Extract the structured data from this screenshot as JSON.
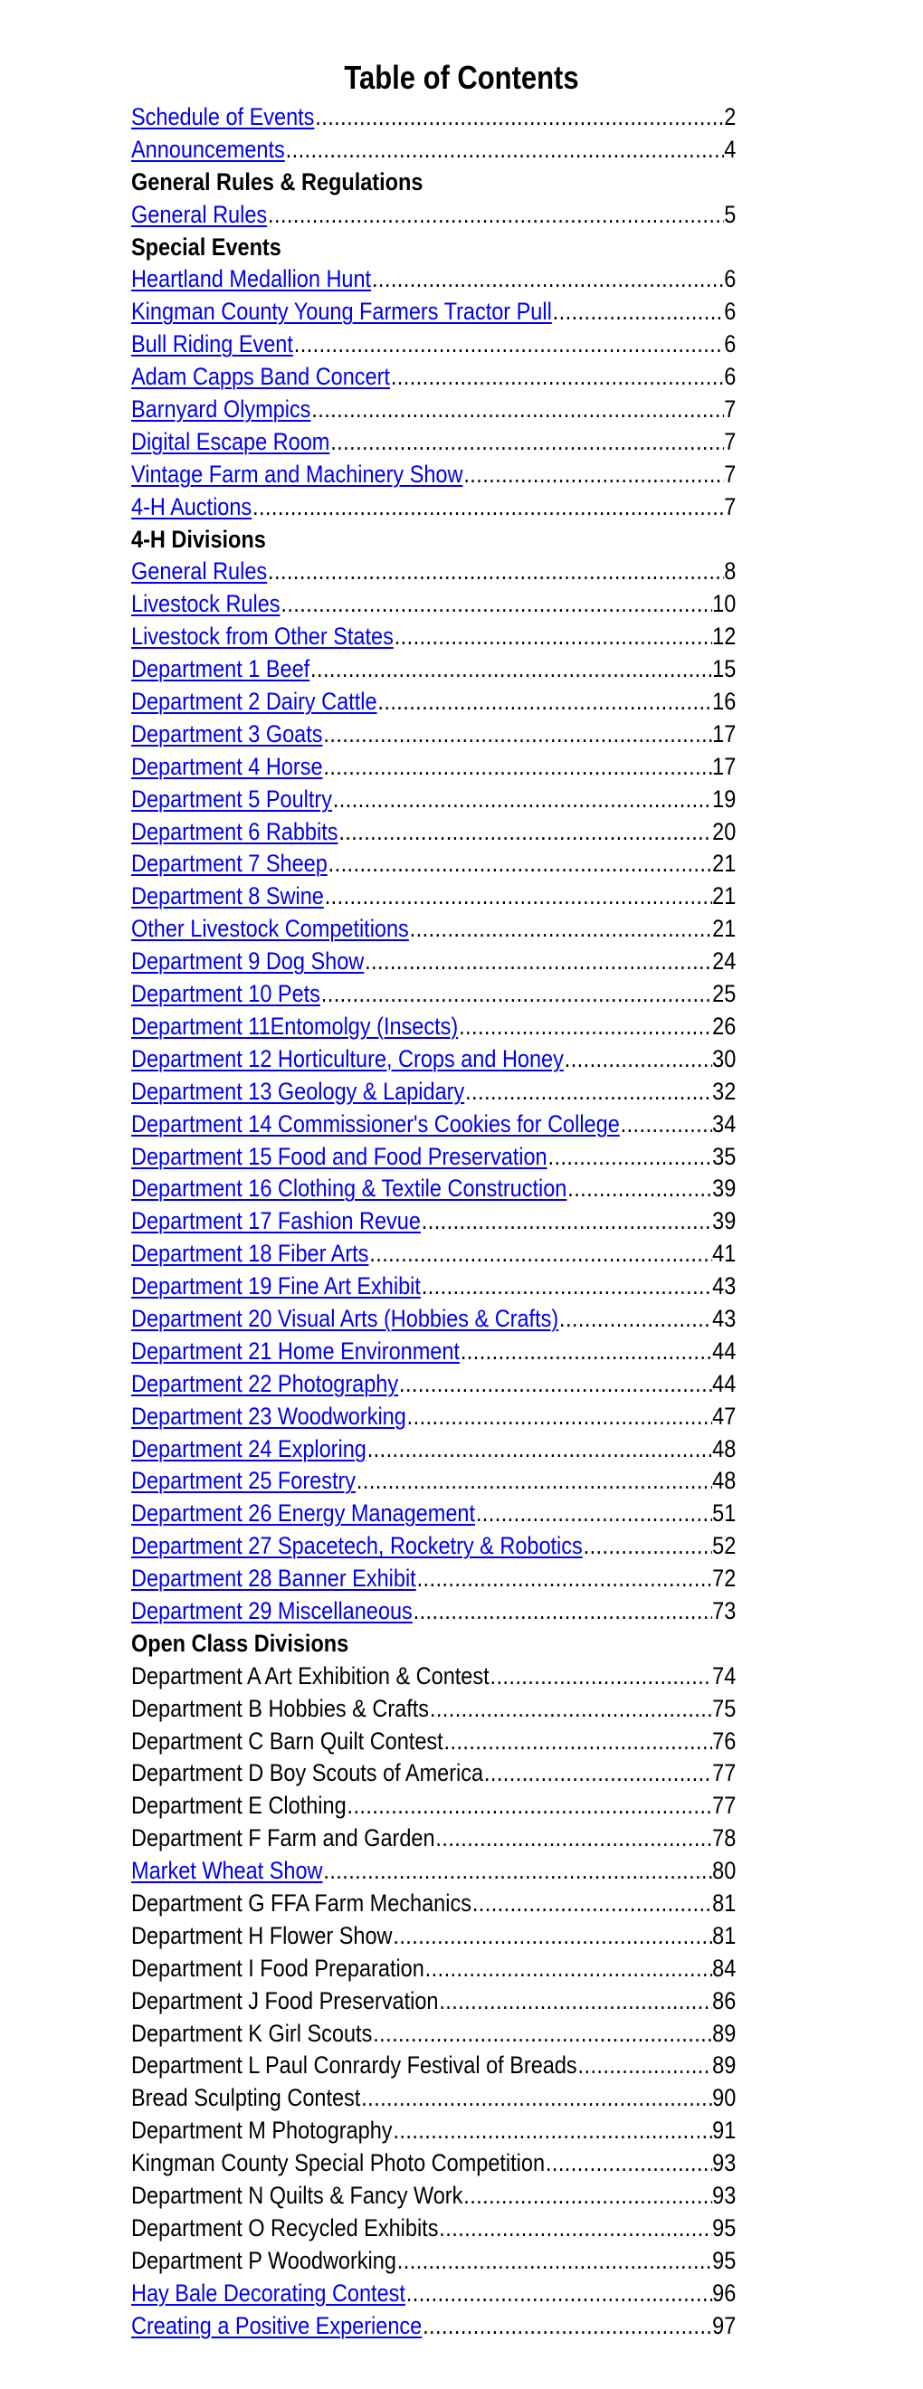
{
  "document": {
    "title": "Table of Contents",
    "link_color": "#0000ee",
    "entries": [
      {
        "type": "entry",
        "label": "Schedule of Events",
        "page": "2",
        "link": true
      },
      {
        "type": "entry",
        "label": "Announcements",
        "page": "4",
        "link": true
      },
      {
        "type": "heading",
        "label": "General Rules & Regulations"
      },
      {
        "type": "entry",
        "label": "General Rules",
        "page": "5",
        "link": true
      },
      {
        "type": "heading",
        "label": "Special Events"
      },
      {
        "type": "entry",
        "label": "Heartland Medallion Hunt",
        "page": "6",
        "link": true
      },
      {
        "type": "entry",
        "label": "Kingman County Young Farmers Tractor Pull",
        "page": "6",
        "link": true
      },
      {
        "type": "entry",
        "label": "Bull Riding Event",
        "page": "6",
        "link": true
      },
      {
        "type": "entry",
        "label": "Adam Capps Band Concert",
        "page": "6",
        "link": true
      },
      {
        "type": "entry",
        "label": "Barnyard Olympics",
        "page": "7",
        "link": true
      },
      {
        "type": "entry",
        "label": "Digital Escape Room",
        "page": "7",
        "link": true
      },
      {
        "type": "entry",
        "label": "Vintage Farm and Machinery Show",
        "page": "7",
        "link": true
      },
      {
        "type": "entry",
        "label": "4-H Auctions",
        "page": "7",
        "link": true
      },
      {
        "type": "heading",
        "label": "4-H Divisions"
      },
      {
        "type": "entry",
        "label": "General Rules",
        "page": "8",
        "link": true
      },
      {
        "type": "entry",
        "label": "Livestock Rules",
        "page": "10",
        "link": true
      },
      {
        "type": "entry",
        "label": "Livestock from Other States",
        "page": "12",
        "link": true
      },
      {
        "type": "entry",
        "label": "Department 1 Beef",
        "page": "15",
        "link": true
      },
      {
        "type": "entry",
        "label": "Department 2 Dairy Cattle",
        "page": "16",
        "link": true
      },
      {
        "type": "entry",
        "label": "Department 3 Goats",
        "page": "17",
        "link": true
      },
      {
        "type": "entry",
        "label": "Department 4 Horse",
        "page": "17",
        "link": true
      },
      {
        "type": "entry",
        "label": "Department 5 Poultry",
        "page": "19",
        "link": true
      },
      {
        "type": "entry",
        "label": "Department 6 Rabbits",
        "page": "20",
        "link": true
      },
      {
        "type": "entry",
        "label": "Department 7 Sheep",
        "page": "21",
        "link": true
      },
      {
        "type": "entry",
        "label": "Department 8 Swine",
        "page": "21",
        "link": true
      },
      {
        "type": "entry",
        "label": "Other Livestock Competitions",
        "page": "21",
        "link": true
      },
      {
        "type": "entry",
        "label": "Department 9 Dog Show",
        "page": "24",
        "link": true
      },
      {
        "type": "entry",
        "label": "Department 10 Pets",
        "page": "25",
        "link": true
      },
      {
        "type": "entry",
        "label": "Department 11Entomolgy (Insects)",
        "page": "26",
        "link": true
      },
      {
        "type": "entry",
        "label": "Department 12 Horticulture, Crops and Honey",
        "page": "30",
        "link": true
      },
      {
        "type": "entry",
        "label": "Department 13 Geology & Lapidary",
        "page": "32",
        "link": true
      },
      {
        "type": "entry",
        "label": "Department 14 Commissioner's Cookies for College",
        "page": "34",
        "link": true
      },
      {
        "type": "entry",
        "label": "Department 15 Food and Food Preservation",
        "page": "35",
        "link": true
      },
      {
        "type": "entry",
        "label": "Department 16 Clothing & Textile Construction",
        "page": "39",
        "link": true
      },
      {
        "type": "entry",
        "label": "Department 17 Fashion Revue",
        "page": "39",
        "link": true
      },
      {
        "type": "entry",
        "label": "Department 18 Fiber Arts",
        "page": "41",
        "link": true
      },
      {
        "type": "entry",
        "label": "Department 19 Fine Art Exhibit",
        "page": "43",
        "link": true
      },
      {
        "type": "entry",
        "label": "Department 20 Visual Arts (Hobbies & Crafts)",
        "page": "43",
        "link": true
      },
      {
        "type": "entry",
        "label": "Department 21 Home Environment",
        "page": "44",
        "link": true
      },
      {
        "type": "entry",
        "label": "Department 22 Photography",
        "page": "44",
        "link": true
      },
      {
        "type": "entry",
        "label": "Department 23 Woodworking",
        "page": "47",
        "link": true
      },
      {
        "type": "entry",
        "label": "Department 24 Exploring",
        "page": "48",
        "link": true
      },
      {
        "type": "entry",
        "label": "Department 25 Forestry",
        "page": "48",
        "link": true
      },
      {
        "type": "entry",
        "label": "Department 26 Energy Management",
        "page": "51",
        "link": true
      },
      {
        "type": "entry",
        "label": "Department 27 Spacetech, Rocketry & Robotics",
        "page": "52",
        "link": true
      },
      {
        "type": "entry",
        "label": "Department 28 Banner Exhibit",
        "page": "72",
        "link": true
      },
      {
        "type": "entry",
        "label": "Department 29 Miscellaneous",
        "page": "73",
        "link": true
      },
      {
        "type": "heading",
        "label": "Open Class Divisions"
      },
      {
        "type": "entry",
        "label": "Department A Art Exhibition & Contest",
        "page": "74",
        "link": false
      },
      {
        "type": "entry",
        "label": "Department B Hobbies & Crafts",
        "page": "75",
        "link": false
      },
      {
        "type": "entry",
        "label": "Department C Barn Quilt Contest",
        "page": "76",
        "link": false
      },
      {
        "type": "entry",
        "label": "Department D Boy Scouts of America",
        "page": "77",
        "link": false
      },
      {
        "type": "entry",
        "label": "Department E Clothing",
        "page": "77",
        "link": false
      },
      {
        "type": "entry",
        "label": "Department F Farm and Garden",
        "page": "78",
        "link": false
      },
      {
        "type": "entry",
        "label": "Market Wheat Show",
        "page": "80",
        "link": true
      },
      {
        "type": "entry",
        "label": "Department G FFA Farm Mechanics",
        "page": "81",
        "link": false
      },
      {
        "type": "entry",
        "label": "Department H Flower Show",
        "page": "81",
        "link": false
      },
      {
        "type": "entry",
        "label": "Department I Food Preparation",
        "page": "84",
        "link": false
      },
      {
        "type": "entry",
        "label": "Department J Food Preservation",
        "page": "86",
        "link": false
      },
      {
        "type": "entry",
        "label": "Department K Girl Scouts",
        "page": "89",
        "link": false
      },
      {
        "type": "entry",
        "label": "Department L Paul Conrardy Festival of Breads",
        "page": "89",
        "link": false
      },
      {
        "type": "entry",
        "label": "Bread Sculpting Contest",
        "page": "90",
        "link": false
      },
      {
        "type": "entry",
        "label": "Department M Photography",
        "page": "91",
        "link": false
      },
      {
        "type": "entry",
        "label": "Kingman County Special Photo Competition",
        "page": "93",
        "link": false
      },
      {
        "type": "entry",
        "label": "Department N Quilts & Fancy Work",
        "page": "93",
        "link": false
      },
      {
        "type": "entry",
        "label": "Department O Recycled Exhibits",
        "page": "95",
        "link": false
      },
      {
        "type": "entry",
        "label": "Department P Woodworking",
        "page": "95",
        "link": false
      },
      {
        "type": "entry",
        "label": "Hay Bale Decorating Contest",
        "page": "96",
        "link": true
      },
      {
        "type": "entry",
        "label": "Creating a Positive Experience",
        "page": "97",
        "link": true
      }
    ]
  }
}
